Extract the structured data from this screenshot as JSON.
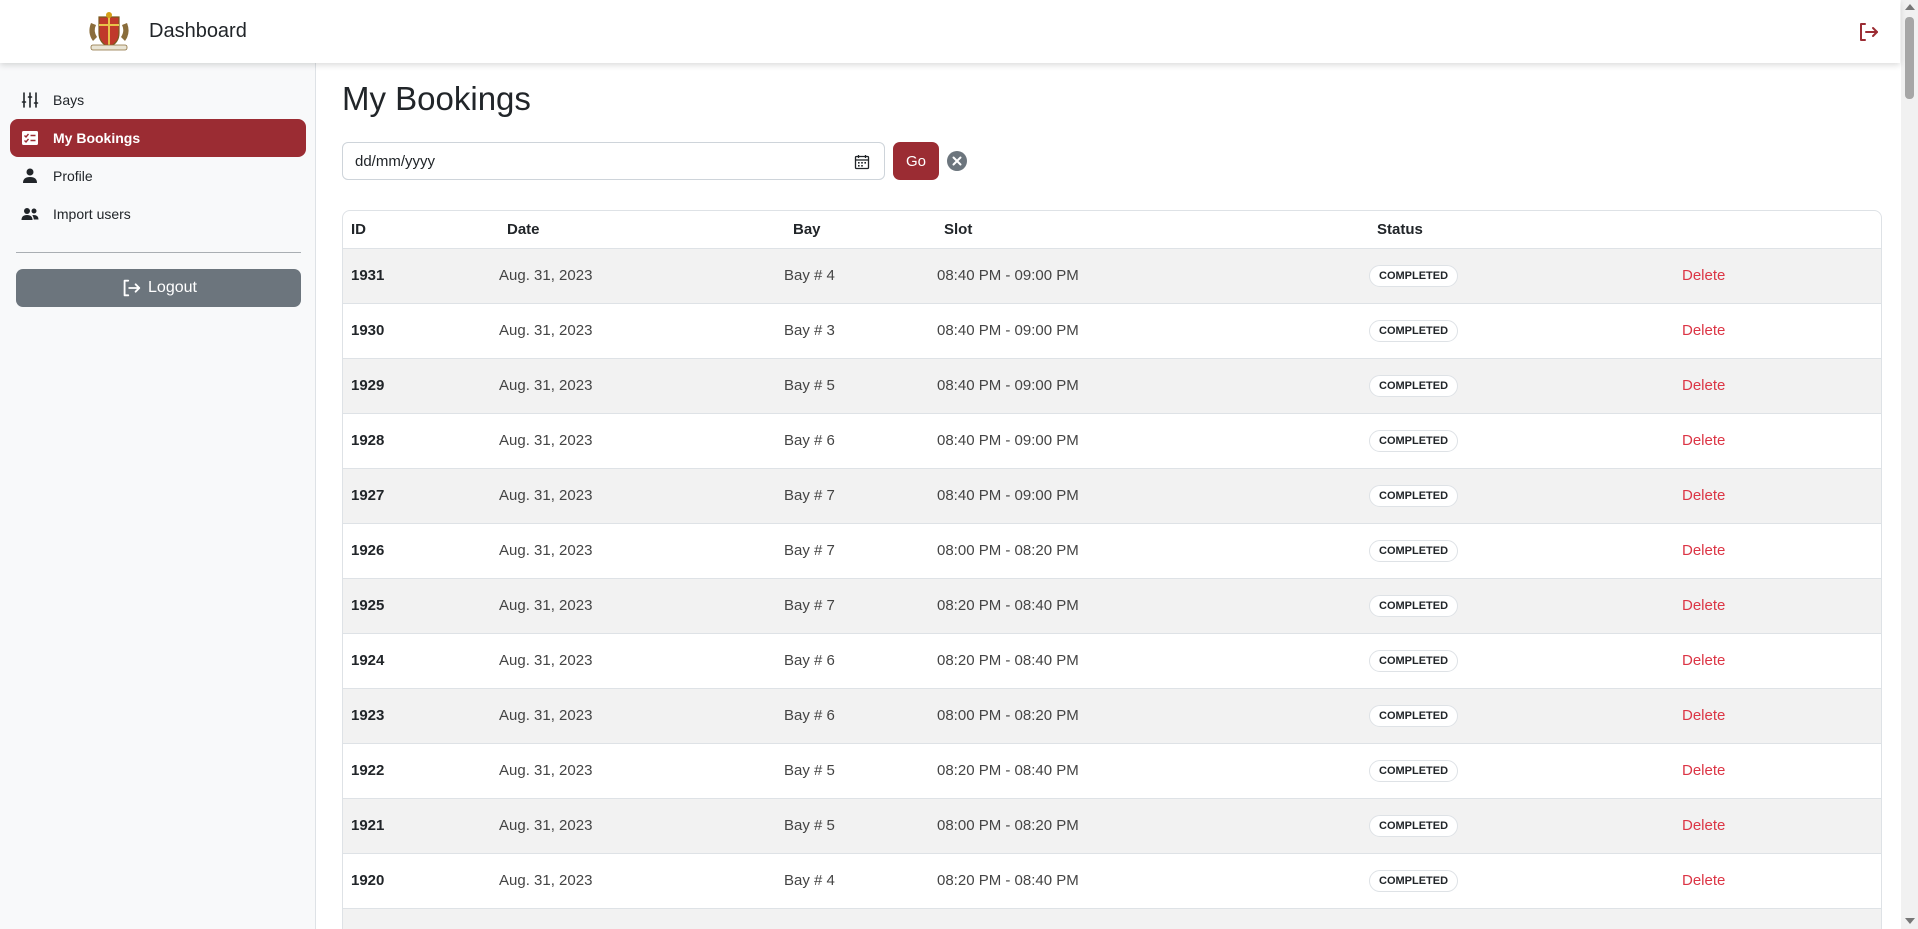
{
  "header": {
    "brand": "Dashboard",
    "logo_icon": "coat-of-arms-logo",
    "exit_icon": "logout-icon"
  },
  "sidebar": {
    "items": [
      {
        "label": "Bays",
        "icon": "sliders-icon",
        "active": false
      },
      {
        "label": "My Bookings",
        "icon": "checklist-icon",
        "active": true
      },
      {
        "label": "Profile",
        "icon": "person-icon",
        "active": false
      },
      {
        "label": "Import users",
        "icon": "people-icon",
        "active": false
      }
    ],
    "logout_label": "Logout"
  },
  "main": {
    "title": "My Bookings",
    "filter": {
      "placeholder": "dd/mm/yyyy",
      "go_label": "Go"
    },
    "table": {
      "headers": [
        "ID",
        "Date",
        "Bay",
        "Slot",
        "Status"
      ],
      "rows": [
        {
          "id": "1931",
          "date": "Aug. 31, 2023",
          "bay": "Bay # 4",
          "slot": "08:40 PM - 09:00 PM",
          "status": "COMPLETED",
          "action": "Delete"
        },
        {
          "id": "1930",
          "date": "Aug. 31, 2023",
          "bay": "Bay # 3",
          "slot": "08:40 PM - 09:00 PM",
          "status": "COMPLETED",
          "action": "Delete"
        },
        {
          "id": "1929",
          "date": "Aug. 31, 2023",
          "bay": "Bay # 5",
          "slot": "08:40 PM - 09:00 PM",
          "status": "COMPLETED",
          "action": "Delete"
        },
        {
          "id": "1928",
          "date": "Aug. 31, 2023",
          "bay": "Bay # 6",
          "slot": "08:40 PM - 09:00 PM",
          "status": "COMPLETED",
          "action": "Delete"
        },
        {
          "id": "1927",
          "date": "Aug. 31, 2023",
          "bay": "Bay # 7",
          "slot": "08:40 PM - 09:00 PM",
          "status": "COMPLETED",
          "action": "Delete"
        },
        {
          "id": "1926",
          "date": "Aug. 31, 2023",
          "bay": "Bay # 7",
          "slot": "08:00 PM - 08:20 PM",
          "status": "COMPLETED",
          "action": "Delete"
        },
        {
          "id": "1925",
          "date": "Aug. 31, 2023",
          "bay": "Bay # 7",
          "slot": "08:20 PM - 08:40 PM",
          "status": "COMPLETED",
          "action": "Delete"
        },
        {
          "id": "1924",
          "date": "Aug. 31, 2023",
          "bay": "Bay # 6",
          "slot": "08:20 PM - 08:40 PM",
          "status": "COMPLETED",
          "action": "Delete"
        },
        {
          "id": "1923",
          "date": "Aug. 31, 2023",
          "bay": "Bay # 6",
          "slot": "08:00 PM - 08:20 PM",
          "status": "COMPLETED",
          "action": "Delete"
        },
        {
          "id": "1922",
          "date": "Aug. 31, 2023",
          "bay": "Bay # 5",
          "slot": "08:20 PM - 08:40 PM",
          "status": "COMPLETED",
          "action": "Delete"
        },
        {
          "id": "1921",
          "date": "Aug. 31, 2023",
          "bay": "Bay # 5",
          "slot": "08:00 PM - 08:20 PM",
          "status": "COMPLETED",
          "action": "Delete"
        },
        {
          "id": "1920",
          "date": "Aug. 31, 2023",
          "bay": "Bay # 4",
          "slot": "08:20 PM - 08:40 PM",
          "status": "COMPLETED",
          "action": "Delete"
        }
      ]
    }
  },
  "colors": {
    "accent": "#9b2c33",
    "danger": "#dc3545",
    "secondary": "#6c757d"
  }
}
